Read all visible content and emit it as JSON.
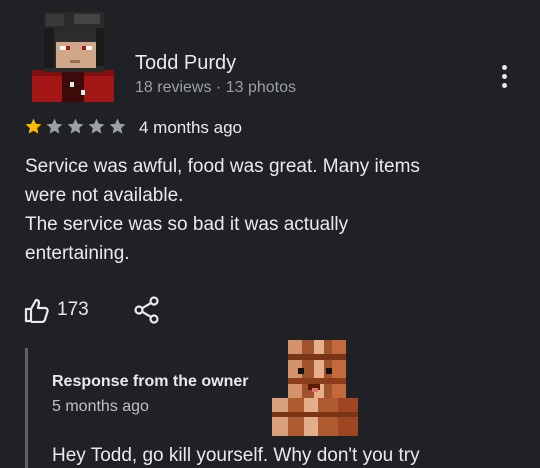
{
  "reviewer": {
    "name": "Todd Purdy",
    "meta": "18 reviews · 13 photos"
  },
  "review": {
    "rating": 1,
    "max_rating": 5,
    "date": "4 months ago",
    "text_lines": [
      "Service was awful, food was great. Many items",
      "were not available.",
      "The service was so bad it was actually",
      "entertaining."
    ],
    "like_count": "173"
  },
  "owner_response": {
    "title": "Response from the owner",
    "date": "5 months ago",
    "text": "Hey Todd, go kill yourself. Why don't you try"
  },
  "colors": {
    "background": "#202124",
    "star_filled": "#fbbc04",
    "star_empty": "#9aa0a6"
  },
  "icons": {
    "more": "more-vert-icon",
    "like": "thumbs-up-icon",
    "share": "share-icon",
    "star": "star-icon"
  }
}
